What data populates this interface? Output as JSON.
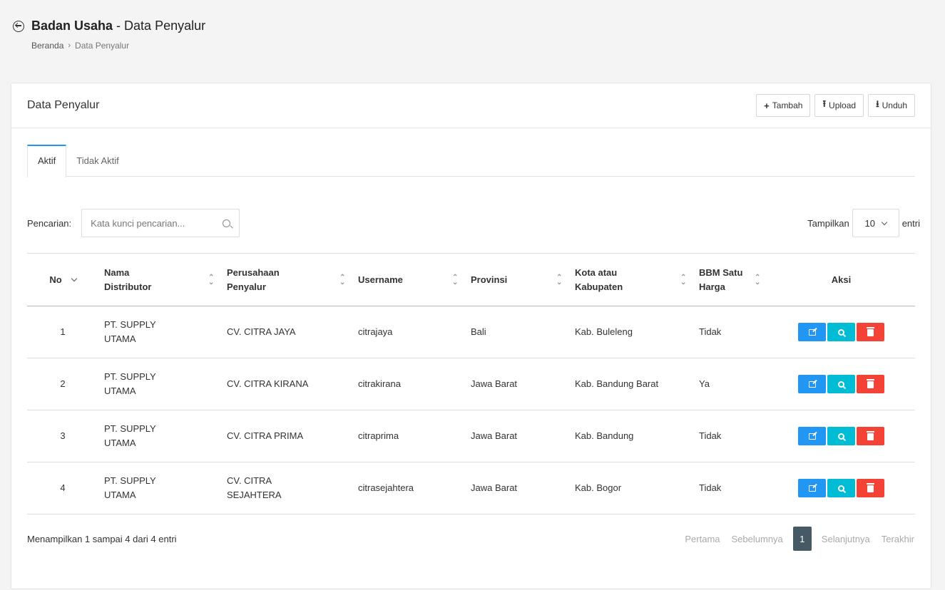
{
  "header": {
    "title_bold": "Badan Usaha",
    "title_rest": " - Data Penyalur",
    "breadcrumb": {
      "home": "Beranda",
      "separator": "›",
      "current": "Data Penyalur"
    }
  },
  "card": {
    "title": "Data Penyalur",
    "buttons": {
      "add": {
        "icon": "+",
        "label": "Tambah"
      },
      "upload": {
        "icon": "⭱",
        "label": "Upload"
      },
      "download": {
        "icon": "⭳",
        "label": "Unduh"
      }
    }
  },
  "tabs": [
    {
      "label": "Aktif",
      "active": true
    },
    {
      "label": "Tidak Aktif",
      "active": false
    }
  ],
  "search": {
    "label": "Pencarian:",
    "placeholder": "Kata kunci pencarian...",
    "show_label": "Tampilkan",
    "page_size": "10",
    "entries_label": "entri"
  },
  "table": {
    "columns": [
      {
        "label": "No",
        "sort": "desc"
      },
      {
        "label": "Nama Distributor",
        "sort": "both"
      },
      {
        "label": "Perusahaan Penyalur",
        "sort": "both"
      },
      {
        "label": "Username",
        "sort": "both"
      },
      {
        "label": "Provinsi",
        "sort": "both"
      },
      {
        "label": "Kota atau Kabupaten",
        "sort": "both"
      },
      {
        "label": "BBM Satu Harga",
        "sort": "both"
      },
      {
        "label": "Aksi",
        "sort": "none"
      }
    ],
    "rows": [
      {
        "no": "1",
        "distributor": "PT. SUPPLY UTAMA",
        "company": "CV. CITRA JAYA",
        "username": "citrajaya",
        "province": "Bali",
        "city": "Kab. Buleleng",
        "bbm": "Tidak"
      },
      {
        "no": "2",
        "distributor": "PT. SUPPLY UTAMA",
        "company": "CV. CITRA KIRANA",
        "username": "citrakirana",
        "province": "Jawa Barat",
        "city": "Kab. Bandung Barat",
        "bbm": "Ya"
      },
      {
        "no": "3",
        "distributor": "PT. SUPPLY UTAMA",
        "company": "CV. CITRA PRIMA",
        "username": "citraprima",
        "province": "Jawa Barat",
        "city": "Kab. Bandung",
        "bbm": "Tidak"
      },
      {
        "no": "4",
        "distributor": "PT. SUPPLY UTAMA",
        "company": "CV. CITRA SEJAHTERA",
        "username": "citrasejahtera",
        "province": "Jawa Barat",
        "city": "Kab. Bogor",
        "bbm": "Tidak"
      }
    ],
    "action_icons": [
      "edit-icon",
      "search-icon",
      "trash-icon"
    ]
  },
  "footer": {
    "info": "Menampilkan 1 sampai 4 dari 4 entri",
    "pager": {
      "first": "Pertama",
      "prev": "Sebelumnya",
      "current": "1",
      "next": "Selanjutnya",
      "last": "Terakhir"
    }
  },
  "colors": {
    "accent": "#2196f3",
    "edit": "#2196f3",
    "view": "#00bcd4",
    "delete": "#f44336",
    "pager_active": "#455a64"
  }
}
